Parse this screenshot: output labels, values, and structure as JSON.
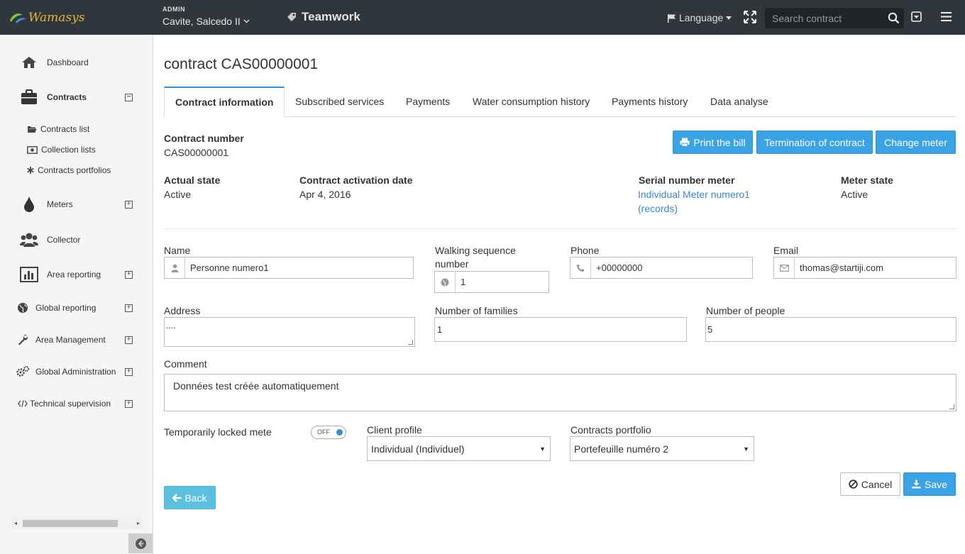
{
  "topbar": {
    "logo_text": "Wamasys",
    "admin_label": "ADMIN",
    "location": "Cavite, Salcedo II",
    "brand": "Teamwork",
    "language": "Language",
    "search_placeholder": "Search contract"
  },
  "sidebar": {
    "dashboard": "Dashboard",
    "contracts": "Contracts",
    "contracts_list": "Contracts list",
    "collection_lists": "Collection lists",
    "contracts_portfolios": "Contracts portfolios",
    "meters": "Meters",
    "collector": "Collector",
    "area_reporting": "Area reporting",
    "global_reporting": "Global reporting",
    "area_management": "Area Management",
    "global_administration": "Global Administration",
    "technical_supervision": "Technical supervision"
  },
  "page": {
    "title": "contract CAS00000001"
  },
  "tabs": [
    {
      "label": "Contract information"
    },
    {
      "label": "Subscribed services"
    },
    {
      "label": "Payments"
    },
    {
      "label": "Water consumption history"
    },
    {
      "label": "Payments history"
    },
    {
      "label": "Data analyse"
    }
  ],
  "info": {
    "contract_number_label": "Contract number",
    "contract_number": "CAS00000001",
    "actual_state_label": "Actual state",
    "actual_state": "Active",
    "activation_label": "Contract activation date",
    "activation_date": "Apr 4, 2016",
    "serial_label": "Serial number meter",
    "serial_link": "Individual Meter numero1",
    "serial_records": "(records)",
    "meter_state_label": "Meter state",
    "meter_state": "Active"
  },
  "actions": {
    "print": "Print the bill",
    "termination": "Termination of contract",
    "change_meter": "Change meter"
  },
  "form": {
    "name_label": "Name",
    "name": "Personne numero1",
    "walking_label_1": "Walking sequence",
    "walking_label_2": "number",
    "walking": "1",
    "phone_label": "Phone",
    "phone": "+00000000",
    "email_label": "Email",
    "email": "thomas@startiji.com",
    "address_label": "Address",
    "address": "....",
    "families_label": "Number of families",
    "families": "1",
    "people_label": "Number of people",
    "people": "5",
    "comment_label": "Comment",
    "comment": "Données test créée automatiquement",
    "locked_label": "Temporarily locked mete",
    "toggle_state": "OFF",
    "client_profile_label": "Client profile",
    "client_profile": "Individual (Individuel)",
    "portfolio_label": "Contracts portfolio",
    "portfolio": "Portefeuille numéro 2"
  },
  "footer": {
    "cancel": "Cancel",
    "save": "Save",
    "back": "Back"
  },
  "colors": {
    "topbar": "#2f373d",
    "primary": "#3aa3e6",
    "back": "#5bc0de",
    "link": "#3a87c6"
  }
}
